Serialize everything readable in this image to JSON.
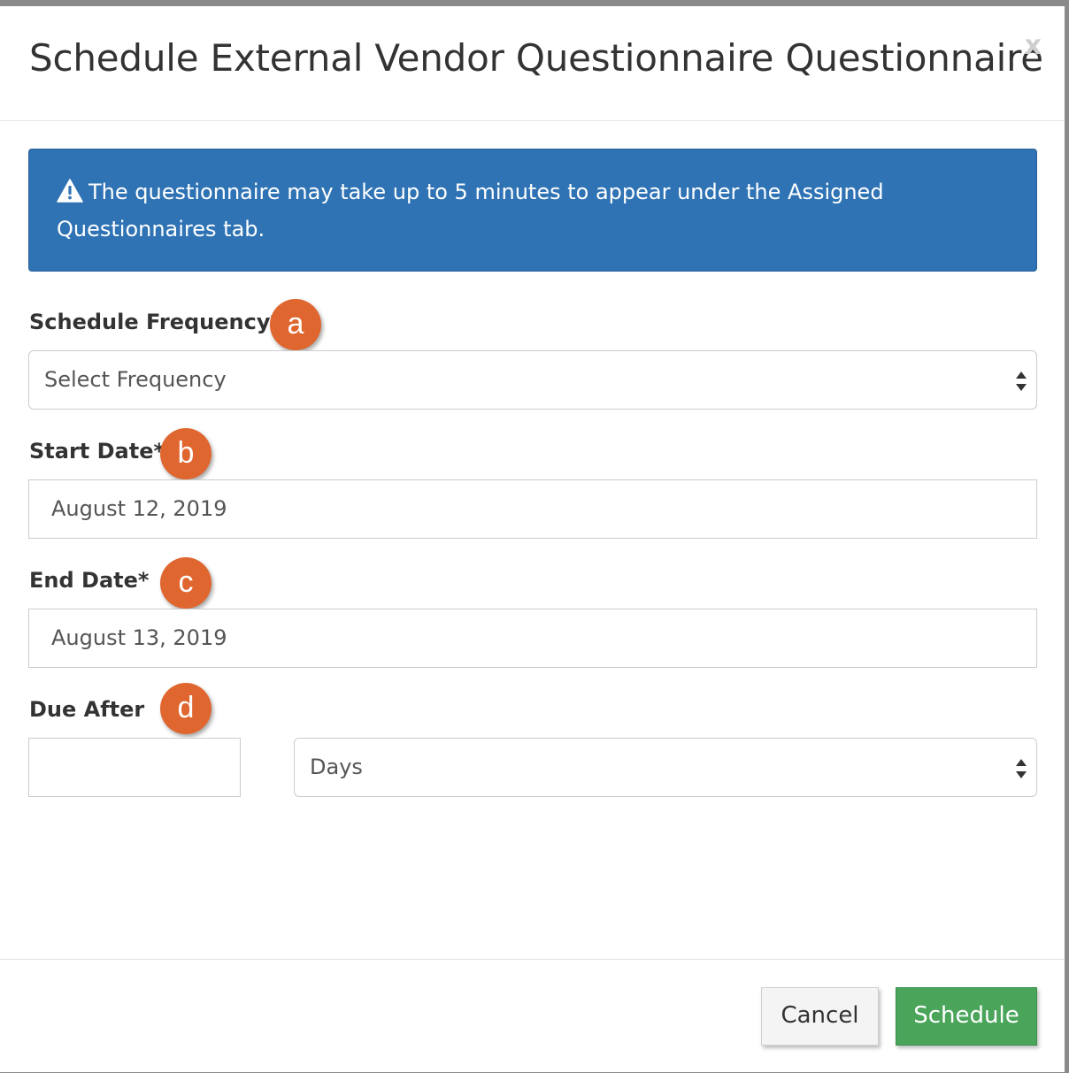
{
  "modal": {
    "title": "Schedule External Vendor Questionnaire Questionnaire",
    "close_label": "x"
  },
  "alert": {
    "icon": "warning-triangle-icon",
    "text": "The questionnaire may take up to 5 minutes to appear under the Assigned Questionnaires tab.",
    "color": "#2f73b5"
  },
  "form": {
    "frequency": {
      "label": "Schedule Frequency*",
      "badge": "a",
      "selected": "Select Frequency"
    },
    "start_date": {
      "label": "Start Date*",
      "badge": "b",
      "value": "August 12, 2019"
    },
    "end_date": {
      "label": "End Date*",
      "badge": "c",
      "value": "August 13, 2019"
    },
    "due_after": {
      "label": "Due After",
      "badge": "d",
      "value": "",
      "unit_selected": "Days"
    }
  },
  "footer": {
    "cancel_label": "Cancel",
    "schedule_label": "Schedule",
    "schedule_color": "#4aa55b"
  },
  "badge_color": "#e0662f"
}
